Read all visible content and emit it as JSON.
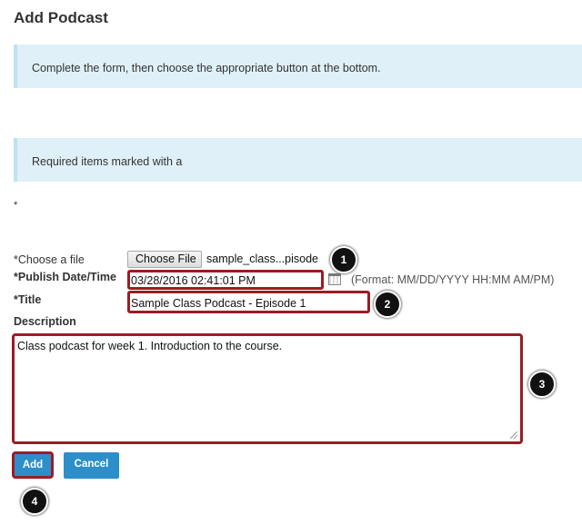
{
  "page": {
    "title": "Add Podcast"
  },
  "info": {
    "instructions": "Complete the form, then choose the appropriate button at the bottom.",
    "required_note": "Required items marked with a",
    "required_star": "*"
  },
  "form": {
    "file_label": "*Choose a file",
    "choose_file_button": "Choose File",
    "file_name": "sample_class...pisode",
    "date_label": "*Publish Date/Time",
    "date_value": "03/28/2016 02:41:01 PM",
    "date_format_hint": "(Format: MM/DD/YYYY HH:MM AM/PM)",
    "title_label": "*Title",
    "title_value": "Sample Class Podcast - Episode 1",
    "description_label": "Description",
    "description_value": "Class podcast for week 1. Introduction to the course."
  },
  "buttons": {
    "add": "Add",
    "cancel": "Cancel"
  },
  "callouts": [
    "1",
    "2",
    "3",
    "4"
  ],
  "colors": {
    "highlight": "#9b1c25",
    "button": "#2d8fc9",
    "info_bg": "#dff0f8"
  }
}
